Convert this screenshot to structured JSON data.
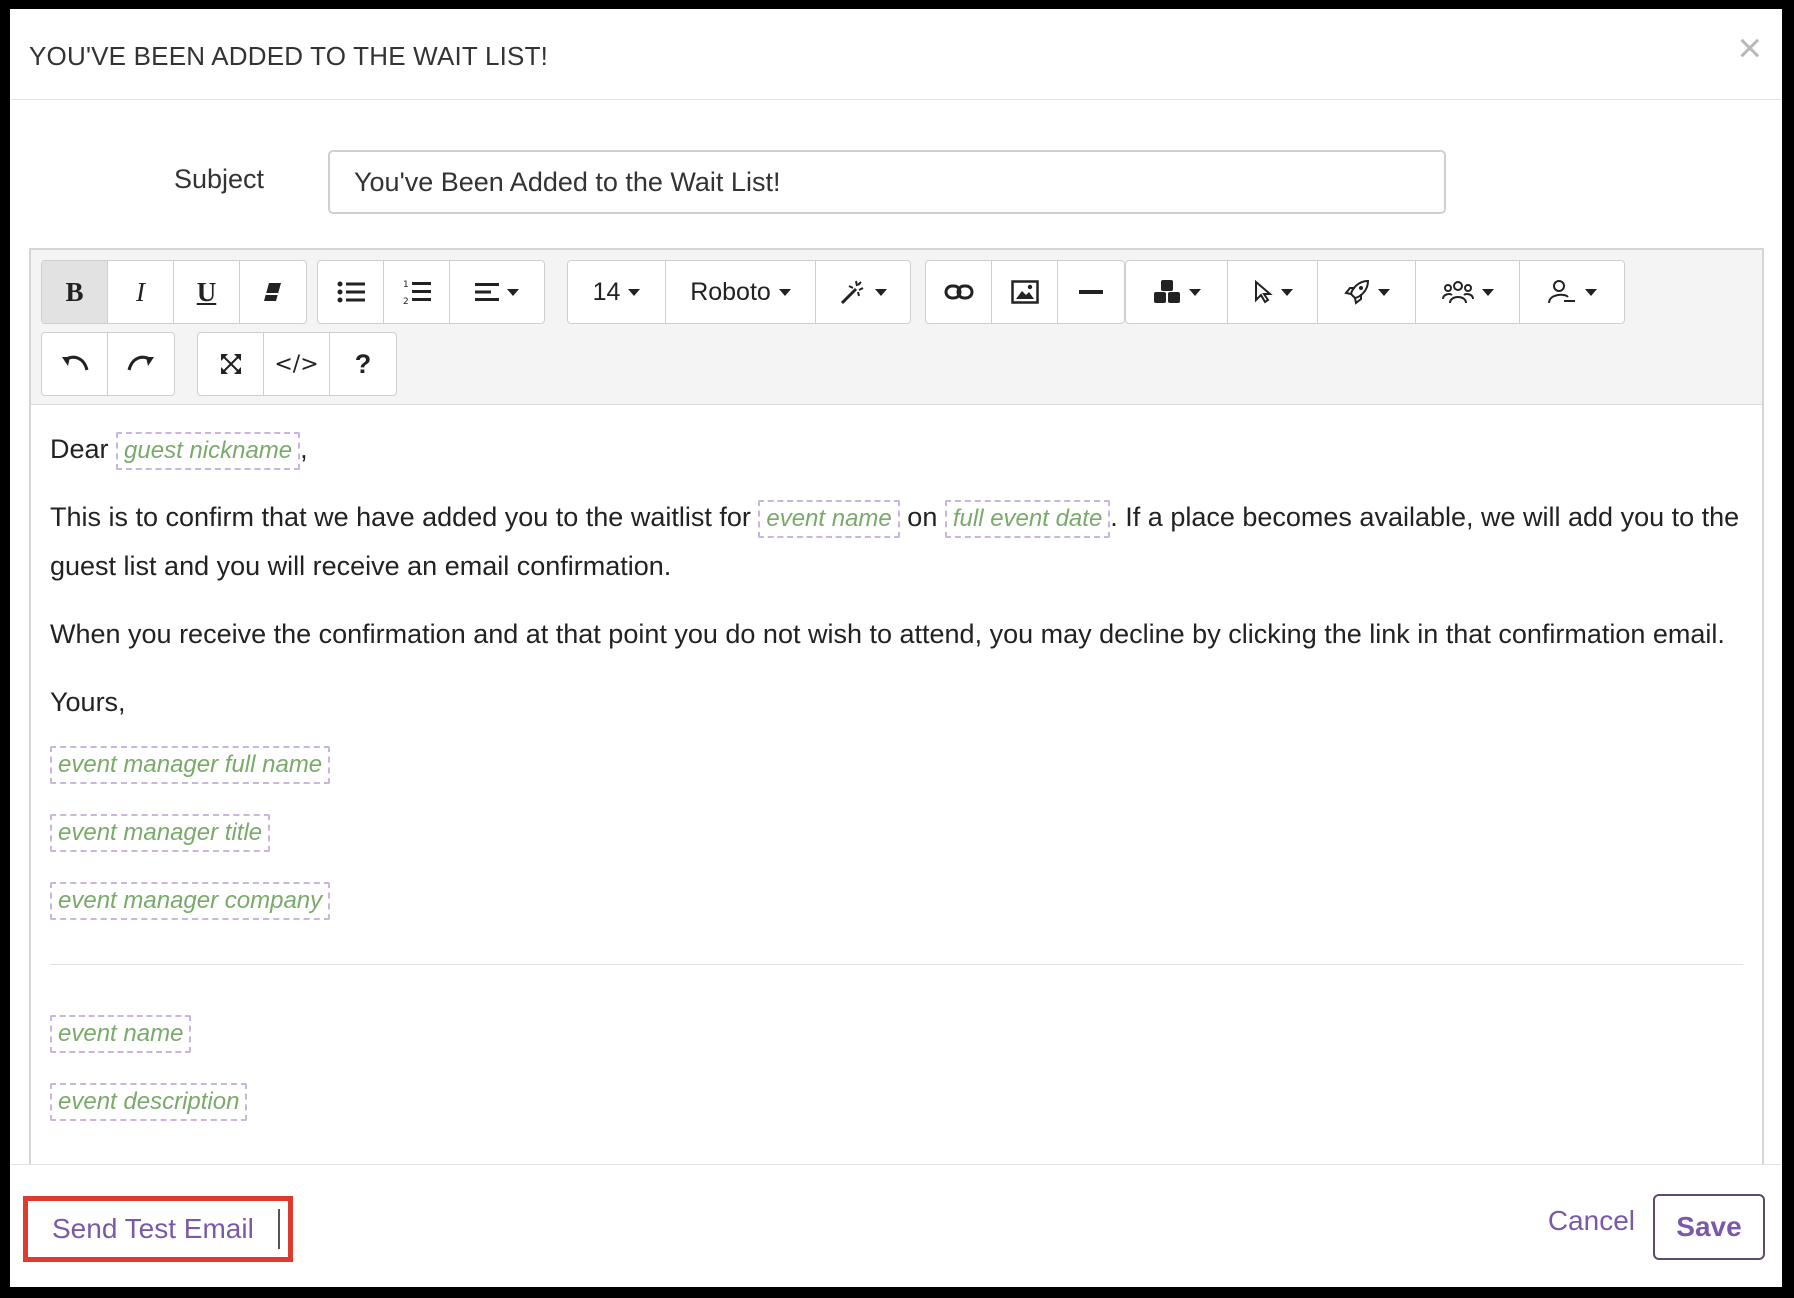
{
  "dialog": {
    "title": "YOU'VE BEEN ADDED TO THE WAIT LIST!",
    "close_glyph": "×"
  },
  "form": {
    "subject_label": "Subject",
    "subject_value": "You've Been Added to the Wait List!"
  },
  "toolbar": {
    "bold": "B",
    "italic": "I",
    "underline": "U",
    "font_size": "14",
    "font_family": "Roboto",
    "code": "</>",
    "help": "?"
  },
  "body": {
    "greeting": "Dear",
    "greeting_tag": "guest nickname",
    "greeting_end": ",",
    "p1_start": "This is to confirm that we have added you to the waitlist for",
    "p1_tag1": "event name",
    "p1_mid": "on",
    "p1_tag2": "full event date",
    "p1_end": ". If a place becomes available, we will add you to the guest list and you will receive an email confirmation.",
    "p2": "When you receive the confirmation and at that point you do not wish to attend, you may decline by clicking the link in that confirmation email.",
    "closing": "Yours,",
    "sig_tags": [
      "event manager full name",
      "event manager title",
      "event manager company"
    ],
    "after_hr_tags": [
      "event name",
      "event description"
    ]
  },
  "footer": {
    "send_test_label": "Send Test Email",
    "cancel_label": "Cancel",
    "save_label": "Save"
  },
  "colors": {
    "accent": "#7a5aa8",
    "highlight": "#e03a2e",
    "tag_text": "#7aaa6b",
    "tag_border": "#c9b5e0"
  }
}
